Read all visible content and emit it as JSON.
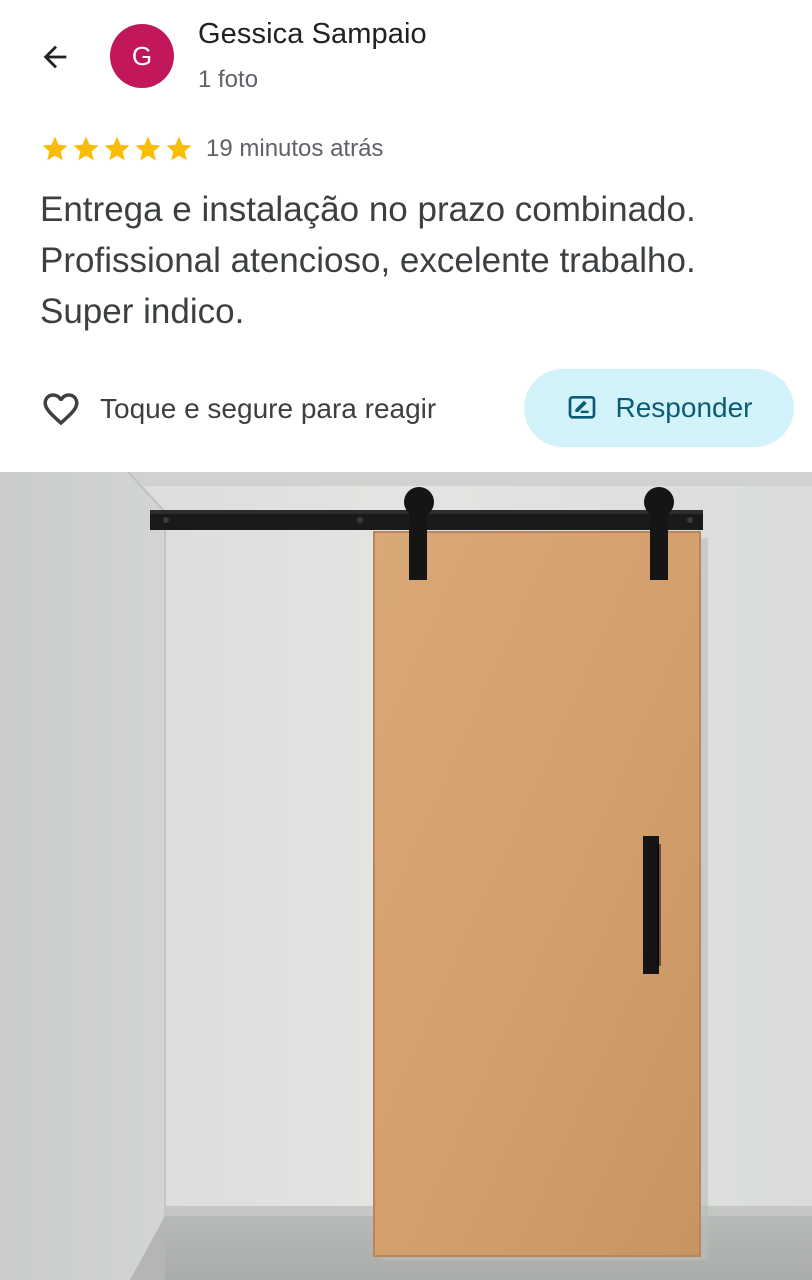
{
  "colors": {
    "avatar_bg": "#c2185b",
    "star": "#fbbc04",
    "reply_bg": "#d3f3fb",
    "reply_fg": "#0b5c73",
    "icon": "#3c4043"
  },
  "header": {
    "back_icon": "arrow-left-icon",
    "avatar_initial": "G",
    "author_name": "Gessica Sampaio",
    "photo_count": "1 foto"
  },
  "review": {
    "rating": 5,
    "rating_max": 5,
    "time_ago": "19 minutos atrás",
    "text": "Entrega e instalação no prazo combinado. Profissional atencioso, excelente trabalho. Super indico."
  },
  "actions": {
    "react_icon": "heart-outline-icon",
    "react_label": "Toque e segure para reagir",
    "reply_icon": "reply-edit-icon",
    "reply_label": "Responder"
  },
  "photo": {
    "subject_icon": "sliding-barn-door-photo"
  }
}
